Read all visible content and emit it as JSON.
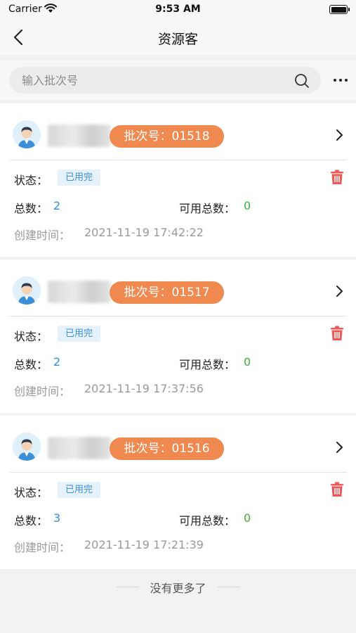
{
  "status_bar": {
    "carrier": "Carrier",
    "time": "9:53 AM"
  },
  "nav": {
    "title": "资源客"
  },
  "search": {
    "placeholder": "输入批次号",
    "value": ""
  },
  "records": [
    {
      "batch_label": "批次号：01518",
      "status_label": "状态：",
      "status_value": "已用完",
      "total_label": "总数：",
      "total_value": "2",
      "available_label": "可用总数：",
      "available_value": "0",
      "created_label": "创建时间：",
      "created_value": "2021-11-19 17:42:22"
    },
    {
      "batch_label": "批次号：01517",
      "status_label": "状态：",
      "status_value": "已用完",
      "total_label": "总数：",
      "total_value": "2",
      "available_label": "可用总数：",
      "available_value": "0",
      "created_label": "创建时间：",
      "created_value": "2021-11-19 17:37:56"
    },
    {
      "batch_label": "批次号：01516",
      "status_label": "状态：",
      "status_value": "已用完",
      "total_label": "总数：",
      "total_value": "3",
      "available_label": "可用总数：",
      "available_value": "0",
      "created_label": "创建时间：",
      "created_value": "2021-11-19 17:21:39"
    }
  ],
  "footer": {
    "end_text": "没有更多了"
  },
  "colors": {
    "badge": "#f0894f",
    "total_value": "#2f8fe0",
    "available_value": "#3bb13b",
    "delete": "#ef5757",
    "status_tag_bg": "#e6f2fb",
    "status_tag_text": "#3a8fd6"
  },
  "icons": [
    "wifi-icon",
    "battery-icon",
    "back-arrow-icon",
    "search-icon",
    "more-dots-icon",
    "avatar-person-icon",
    "chevron-right-icon",
    "trash-icon"
  ]
}
